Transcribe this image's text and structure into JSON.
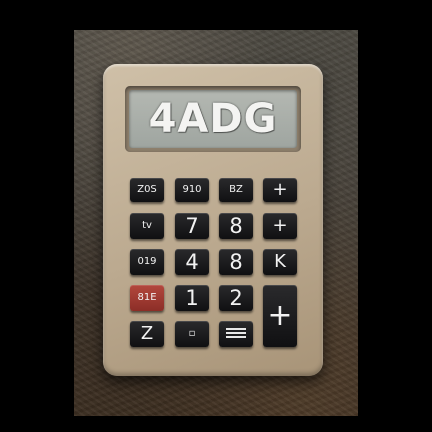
{
  "display": {
    "text": "4ADG"
  },
  "keys": [
    {
      "id": "r1c1",
      "label": "Z0S"
    },
    {
      "id": "r1c2",
      "label": "910"
    },
    {
      "id": "r1c3",
      "label": "BZ"
    },
    {
      "id": "r1c4",
      "label": "+"
    },
    {
      "id": "r2c1",
      "label": "tv"
    },
    {
      "id": "r2c2",
      "label": "7"
    },
    {
      "id": "r2c3",
      "label": "8"
    },
    {
      "id": "r2c4",
      "label": "+"
    },
    {
      "id": "r3c1",
      "label": "019"
    },
    {
      "id": "r3c2",
      "label": "4"
    },
    {
      "id": "r3c3",
      "label": "8"
    },
    {
      "id": "r3c4",
      "label": "K"
    },
    {
      "id": "r4c1",
      "label": "81E"
    },
    {
      "id": "r4c2",
      "label": "1"
    },
    {
      "id": "r4c3",
      "label": "2"
    },
    {
      "id": "r4c4",
      "label": "+"
    },
    {
      "id": "r5c1",
      "label": "Z"
    },
    {
      "id": "r5c2",
      "label": "▫"
    },
    {
      "id": "r5c3",
      "label": ""
    }
  ],
  "colors": {
    "body": "#c4b49b",
    "display": "#a7aca7",
    "key": "#1a1a1c",
    "accent_key": "#a33a31"
  }
}
